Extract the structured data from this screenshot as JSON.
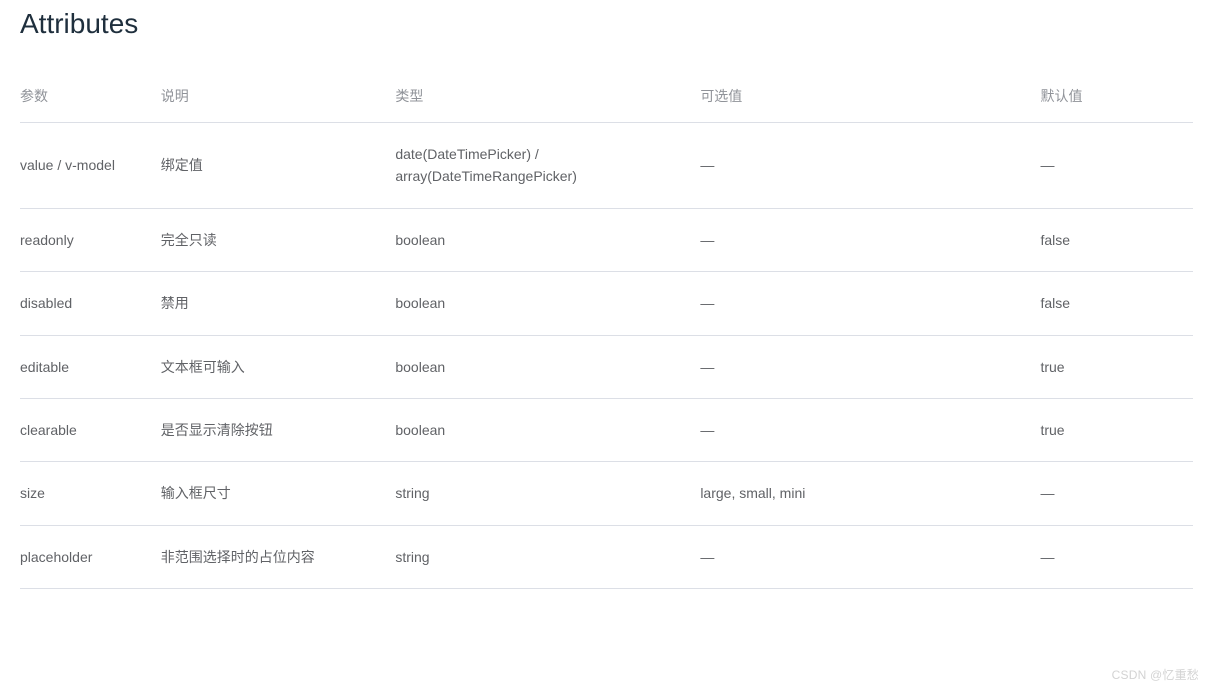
{
  "section_title": "Attributes",
  "table": {
    "headers": [
      "参数",
      "说明",
      "类型",
      "可选值",
      "默认值"
    ],
    "rows": [
      {
        "param": "value / v-model",
        "desc": "绑定值",
        "type": "date(DateTimePicker) / array(DateTimeRangePicker)",
        "options": "—",
        "default": "—"
      },
      {
        "param": "readonly",
        "desc": "完全只读",
        "type": "boolean",
        "options": "—",
        "default": "false"
      },
      {
        "param": "disabled",
        "desc": "禁用",
        "type": "boolean",
        "options": "—",
        "default": "false"
      },
      {
        "param": "editable",
        "desc": "文本框可输入",
        "type": "boolean",
        "options": "—",
        "default": "true"
      },
      {
        "param": "clearable",
        "desc": "是否显示清除按钮",
        "type": "boolean",
        "options": "—",
        "default": "true"
      },
      {
        "param": "size",
        "desc": "输入框尺寸",
        "type": "string",
        "options": "large, small, mini",
        "default": "—"
      },
      {
        "param": "placeholder",
        "desc": "非范围选择时的占位内容",
        "type": "string",
        "options": "—",
        "default": "—"
      }
    ]
  },
  "watermark": "CSDN @忆重愁"
}
